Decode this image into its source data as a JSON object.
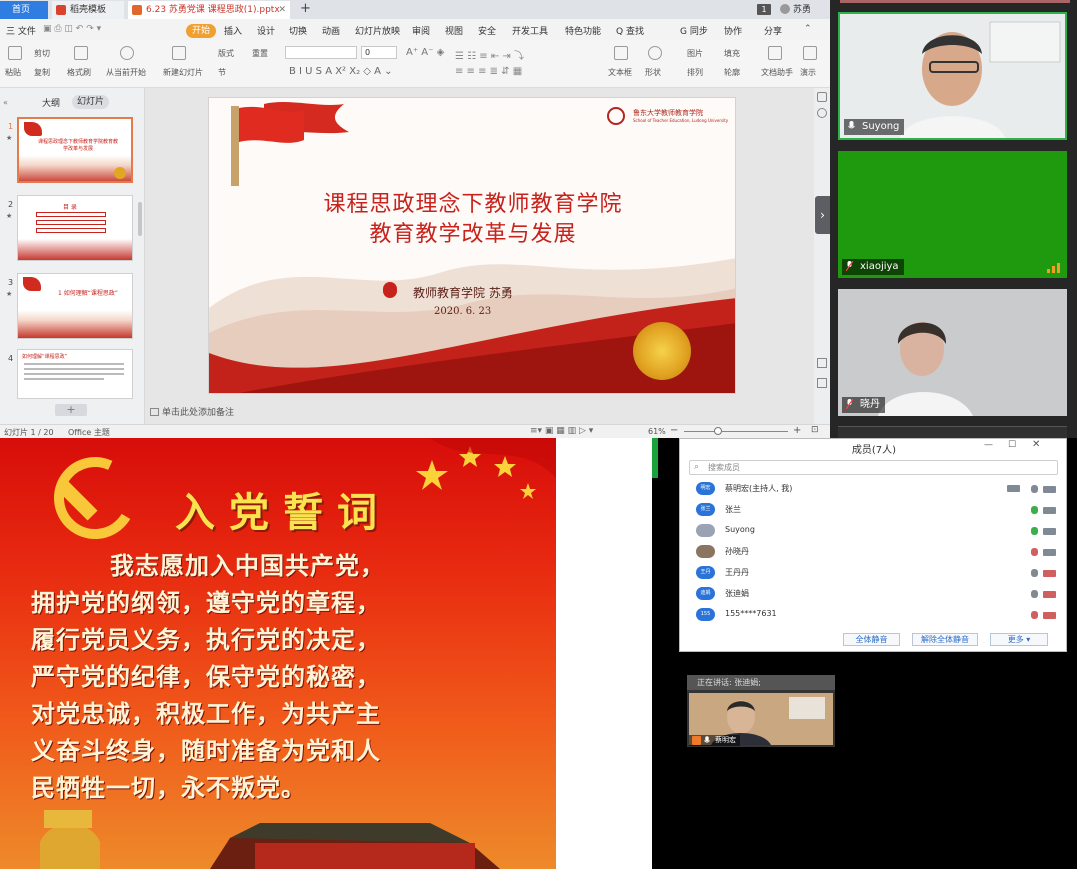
{
  "wps": {
    "tabs": [
      {
        "label": "首页"
      },
      {
        "label": "稻壳模板"
      },
      {
        "label": "6.23 苏勇党课 课程思政(1).pptx"
      }
    ],
    "page_counter": "1",
    "user": "苏勇",
    "menu": [
      "三 文件",
      "开始",
      "插入",
      "设计",
      "切换",
      "动画",
      "幻灯片放映",
      "审阅",
      "视图",
      "安全",
      "开发工具",
      "特色功能",
      "Q 查找"
    ],
    "menu_right": [
      "G 同步",
      "协作",
      "分享"
    ],
    "toolbar": {
      "paste": "粘贴",
      "cut": "剪切",
      "copy": "复制",
      "format_painter": "格式刷",
      "play_from_current": "从当前开始",
      "new_slide": "新建幻灯片",
      "layout": "版式",
      "section": "节",
      "reset": "重置",
      "font_size": "0",
      "textbox": "文本框",
      "shape": "形状",
      "arrange": "排列",
      "outline": "轮廓",
      "image": "图片",
      "fill": "填充",
      "doc_assistant": "文档助手",
      "presenter": "演示"
    },
    "panel_tabs": [
      "大纲",
      "幻灯片"
    ],
    "thumbnails": [
      {
        "num": "1",
        "text": "课程思政理念下教师教育学院教育教学改革与发展"
      },
      {
        "num": "2",
        "text": "目 录"
      },
      {
        "num": "3",
        "text": "1 如何理解“课程思政”"
      },
      {
        "num": "4",
        "text": "如何理解“课程思政”"
      }
    ],
    "add_slide": "+",
    "slide": {
      "school_cn": "鲁东大学教师教育学院",
      "school_en": "School of Teacher Education, Ludong University",
      "title_line1": "课程思政理念下教师教育学院",
      "title_line2": "教育教学改革与发展",
      "author": "教师教育学院  苏勇",
      "date": "2020. 6. 23"
    },
    "notes_placeholder": "单击此处添加备注",
    "status": {
      "slide_index": "幻灯片 1 / 20",
      "theme": "Office 主题",
      "zoom": "61%"
    }
  },
  "participants_video": [
    {
      "name": "Suyong"
    },
    {
      "name": "xiaojiya"
    },
    {
      "name": "晓丹"
    }
  ],
  "oath": {
    "title": "入党誓词",
    "lines": [
      "我志愿加入中国共产党，",
      "拥护党的纲领，遵守党的章程，",
      "履行党员义务，执行党的决定，",
      "严守党的纪律，保守党的秘密，",
      "对党忠诚，积极工作，为共产主",
      "义奋斗终身，随时准备为党和人",
      "民牺牲一切，永不叛党。"
    ]
  },
  "members": {
    "title": "成员(7人)",
    "search_placeholder": "搜索成员",
    "list": [
      {
        "avatar": "明宏",
        "name": "蔡明宏(主持人, 我)"
      },
      {
        "avatar": "张兰",
        "name": "张兰"
      },
      {
        "avatar": "",
        "name": "Suyong"
      },
      {
        "avatar": "",
        "name": "孙晓丹"
      },
      {
        "avatar": "王丹",
        "name": "王丹丹"
      },
      {
        "avatar": "迪娟",
        "name": "张迪娟"
      },
      {
        "avatar": "155",
        "name": "155****7631"
      }
    ],
    "buttons": [
      "全体静音",
      "解除全体静音",
      "更多 ▾"
    ]
  },
  "speaker": {
    "header": "正在讲话: 张迪娟;",
    "name": "蔡明宏"
  },
  "colors": {
    "accent_blue": "#2f7de1",
    "party_red": "#d70d0a",
    "gold": "#fbe24f",
    "green_tile": "#1f9a0e"
  }
}
